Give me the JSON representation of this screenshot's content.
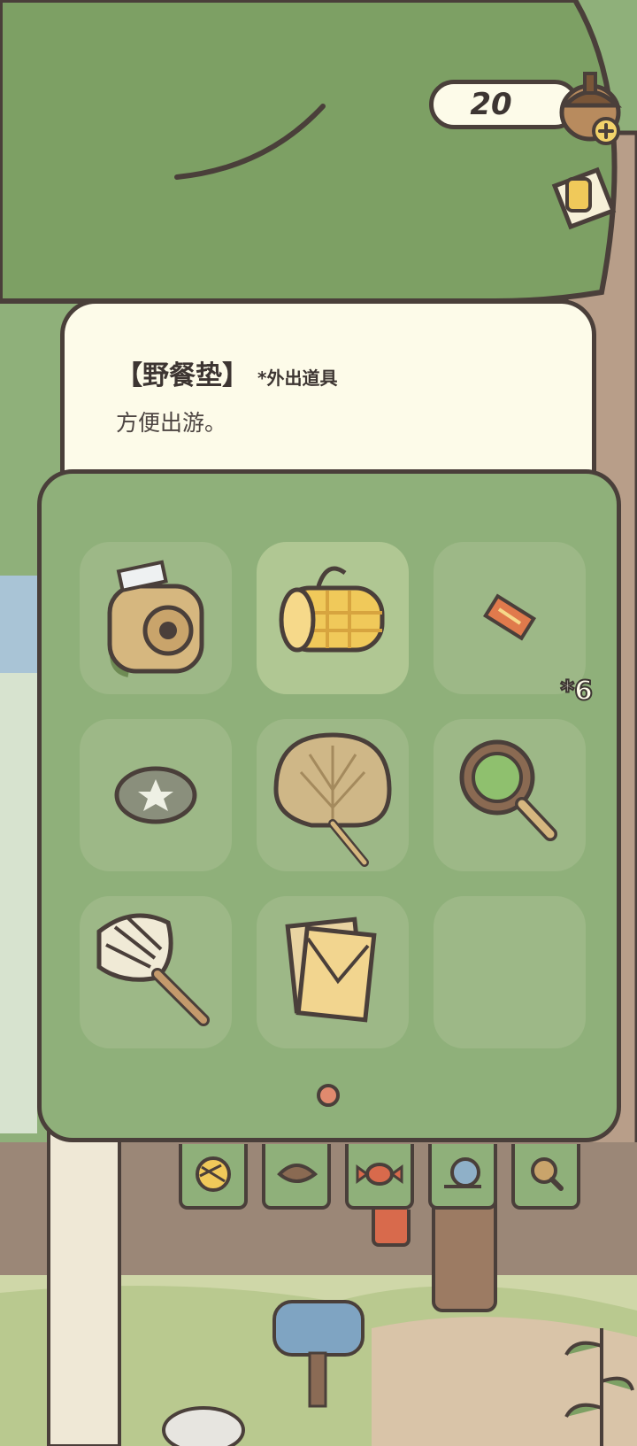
{
  "currency": {
    "amount": "20",
    "icon": "acorn-icon",
    "add_icon": "plus-icon"
  },
  "info": {
    "title": "【野餐垫】",
    "tag": "*外出道具",
    "description": "方便出游。"
  },
  "inventory": {
    "items": [
      {
        "name": "camera",
        "icon": "camera-icon",
        "selected": false,
        "count": ""
      },
      {
        "name": "picnic-mat",
        "icon": "picnic-mat-icon",
        "selected": true,
        "count": ""
      },
      {
        "name": "ticket",
        "icon": "ticket-icon",
        "selected": false,
        "count": "*6"
      },
      {
        "name": "stone",
        "icon": "stone-icon",
        "selected": false,
        "count": ""
      },
      {
        "name": "fan",
        "icon": "fan-icon",
        "selected": false,
        "count": ""
      },
      {
        "name": "magnifier",
        "icon": "magnifier-icon",
        "selected": false,
        "count": ""
      },
      {
        "name": "duster",
        "icon": "duster-icon",
        "selected": false,
        "count": ""
      },
      {
        "name": "letters",
        "icon": "letters-icon",
        "selected": false,
        "count": ""
      },
      {
        "name": "empty",
        "icon": "",
        "selected": false,
        "count": ""
      }
    ],
    "page_indicator": "1"
  },
  "bottom_tabs": [
    "yarn-icon",
    "leaf-icon",
    "candy-icon",
    "snail-icon",
    "search-icon"
  ],
  "colors": {
    "outline": "#4a3f3a",
    "panel": "#8fb07a",
    "card": "#fdfbe9",
    "accent": "#e08a6e"
  }
}
